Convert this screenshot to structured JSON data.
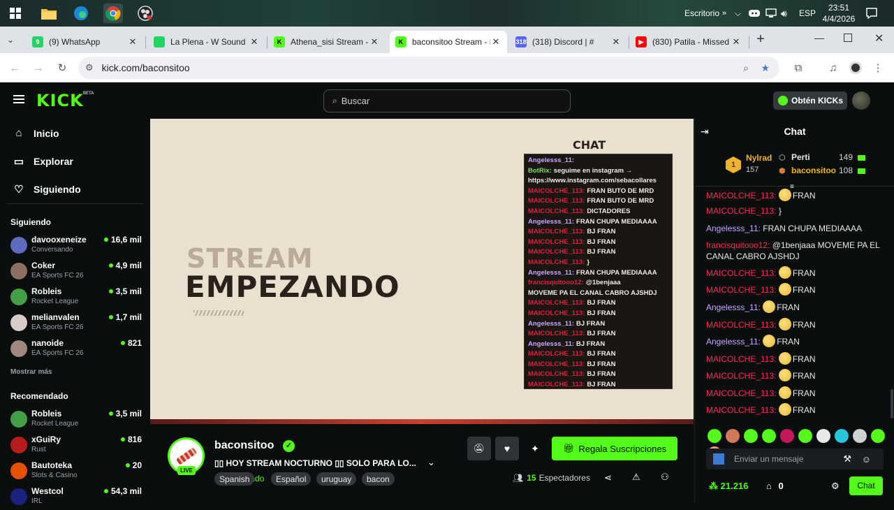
{
  "taskbar": {
    "desktop_label": "Escritorio",
    "lang": "ESP",
    "time": "23:51",
    "date": "4/4/2026"
  },
  "tabs": [
    {
      "title": "(9) WhatsApp",
      "fav": "9",
      "color": "#25d366"
    },
    {
      "title": "La Plena - W Sound",
      "fav": "",
      "color": "#1ed760"
    },
    {
      "title": "Athena_sisi Stream - K",
      "fav": "K",
      "color": "#53fc18"
    },
    {
      "title": "baconsitoo Stream - K",
      "fav": "K",
      "color": "#53fc18"
    },
    {
      "title": "(318) Discord | #",
      "fav": "318",
      "color": "#5865f2"
    },
    {
      "title": "(830) Patila - Missed",
      "fav": "▶",
      "color": "#ff0000"
    }
  ],
  "address": {
    "url": "kick.com/baconsitoo"
  },
  "kick": {
    "logo": "KICK",
    "beta": "BETA",
    "search_placeholder": "Buscar",
    "get_kicks": "Obtén KICKs",
    "nav": {
      "inicio": "Inicio",
      "explorar": "Explorar",
      "siguiendo": "Siguiendo"
    },
    "following_title": "Siguiendo",
    "following": [
      {
        "name": "davooxeneize",
        "category": "Conversando",
        "viewers": "16,6 mil"
      },
      {
        "name": "Coker",
        "category": "EA Sports FC 26",
        "viewers": "4,9 mil"
      },
      {
        "name": "Robleis",
        "category": "Rocket League",
        "viewers": "3,5 mil"
      },
      {
        "name": "melianvalen",
        "category": "EA Sports FC 26",
        "viewers": "1,7 mil"
      },
      {
        "name": "nanoide",
        "category": "EA Sports FC 26",
        "viewers": "821"
      }
    ],
    "show_more": "Mostrar más",
    "recommended_title": "Recomendado",
    "recommended": [
      {
        "name": "Robleis",
        "category": "Rocket League",
        "viewers": "3,5 mil"
      },
      {
        "name": "xGuiRy",
        "category": "Rust",
        "viewers": "816"
      },
      {
        "name": "Bautoteka",
        "category": "Slots & Casino",
        "viewers": "20"
      },
      {
        "name": "Westcol",
        "category": "IRL",
        "viewers": "54,3 mil"
      }
    ]
  },
  "video": {
    "line1": "STREAM",
    "line2": "EMPEZANDO",
    "overlay_title": "CHAT",
    "overlay_lines": [
      {
        "user": "Angelesss_11:",
        "text": "",
        "color": "#c9a6ff"
      },
      {
        "user": "BotRix:",
        "text": "seguime en instagram →",
        "color": "#7ee06a"
      },
      {
        "user": "",
        "text": "https://www.instagram.com/sebacollares",
        "color": "#ffffff"
      },
      {
        "user": "MAICOLCHE_113:",
        "text": "FRAN BUTO DE MRD",
        "color": "#e0203a"
      },
      {
        "user": "MAICOLCHE_113:",
        "text": "FRAN BUTO DE MRD",
        "color": "#e0203a"
      },
      {
        "user": "MAICOLCHE_113:",
        "text": "DICTADORES",
        "color": "#e0203a"
      },
      {
        "user": "Angelesss_11:",
        "text": "FRAN CHUPA MEDIAAAA",
        "color": "#c9a6ff"
      },
      {
        "user": "MAICOLCHE_113:",
        "text": "BJ FRAN",
        "color": "#e0203a"
      },
      {
        "user": "MAICOLCHE_113:",
        "text": "BJ FRAN",
        "color": "#e0203a"
      },
      {
        "user": "MAICOLCHE_113:",
        "text": "BJ FRAN",
        "color": "#e0203a"
      },
      {
        "user": "MAICOLCHE_113:",
        "text": "}",
        "color": "#e0203a"
      },
      {
        "user": "Angelesss_11:",
        "text": "FRAN CHUPA MEDIAAAA",
        "color": "#c9a6ff"
      },
      {
        "user": "francisquitooo12:",
        "text": "@1benjaaa",
        "color": "#e0203a"
      },
      {
        "user": "",
        "text": "MOVEME PA EL CANAL CABRO AJSHDJ",
        "color": "#ffffff"
      },
      {
        "user": "MAICOLCHE_113:",
        "text": "BJ FRAN",
        "color": "#e0203a"
      },
      {
        "user": "MAICOLCHE_113:",
        "text": "BJ FRAN",
        "color": "#e0203a"
      },
      {
        "user": "Angelesss_11:",
        "text": "BJ FRAN",
        "color": "#c9a6ff"
      },
      {
        "user": "MAICOLCHE_113:",
        "text": "BJ FRAN",
        "color": "#e0203a"
      },
      {
        "user": "Angelesss_11:",
        "text": "BJ FRAN",
        "color": "#c9a6ff"
      },
      {
        "user": "MAICOLCHE_113:",
        "text": "BJ FRAN",
        "color": "#e0203a"
      },
      {
        "user": "MAICOLCHE_113:",
        "text": "BJ FRAN",
        "color": "#e0203a"
      },
      {
        "user": "MAICOLCHE_113:",
        "text": "BJ FRAN",
        "color": "#e0203a"
      },
      {
        "user": "MAICOLCHE_113:",
        "text": "BJ FRAN",
        "color": "#e0203a"
      }
    ]
  },
  "stream": {
    "channel": "baconsitoo",
    "live_badge": "LIVE",
    "title": "▯▯ HOY STREAM NOCTURNO ▯▯ SOLO PARA LO...",
    "category": "Conversando",
    "tags": [
      "Spanish",
      "Español",
      "uruguay",
      "bacon"
    ],
    "sub_button": "Regala Suscripciones",
    "viewers_count": "15",
    "viewers_label": "Espectadores"
  },
  "chat": {
    "title": "Chat",
    "leaderboard": [
      {
        "rank": "1",
        "name": "Nylrad",
        "count": "157"
      },
      {
        "rank": "",
        "name": "Perti",
        "count": "149"
      },
      {
        "rank": "",
        "name": "baconsitoo",
        "count": "108"
      }
    ],
    "messages": [
      {
        "user": "MAICOLCHE_113:",
        "text": "FRAN",
        "color": "#ff2d55",
        "emote": true
      },
      {
        "user": "MAICOLCHE_113:",
        "text": "}",
        "color": "#ff2d55",
        "emote": false
      },
      {
        "user": "Angelesss_11:",
        "text": "FRAN CHUPA MEDIAAAA",
        "color": "#c9a6ff",
        "emote": false
      },
      {
        "user": "francisquitooo12:",
        "text": "@1benjaaa MOVEME PA EL CANAL CABRO AJSHDJ",
        "color": "#ff2d55",
        "emote": false
      },
      {
        "user": "MAICOLCHE_113:",
        "text": "FRAN",
        "color": "#ff2d55",
        "emote": true
      },
      {
        "user": "MAICOLCHE_113:",
        "text": "FRAN",
        "color": "#ff2d55",
        "emote": true
      },
      {
        "user": "Angelesss_11:",
        "text": "FRAN",
        "color": "#c9a6ff",
        "emote": true
      },
      {
        "user": "MAICOLCHE_113:",
        "text": "FRAN",
        "color": "#ff2d55",
        "emote": true
      },
      {
        "user": "Angelesss_11:",
        "text": "FRAN",
        "color": "#c9a6ff",
        "emote": true
      },
      {
        "user": "MAICOLCHE_113:",
        "text": "FRAN",
        "color": "#ff2d55",
        "emote": true
      },
      {
        "user": "MAICOLCHE_113:",
        "text": "FRAN",
        "color": "#ff2d55",
        "emote": true
      },
      {
        "user": "MAICOLCHE_113:",
        "text": "FRAN",
        "color": "#ff2d55",
        "emote": true
      },
      {
        "user": "MAICOLCHE_113:",
        "text": "FRAN",
        "color": "#ff2d55",
        "emote": true
      }
    ],
    "input_placeholder": "Enviar un mensaje",
    "kicks_balance": "21.216",
    "shop_count": "0",
    "send_label": "Chat"
  },
  "colors": {
    "kick_green": "#53fc18",
    "bg": "#0b0e0f"
  }
}
